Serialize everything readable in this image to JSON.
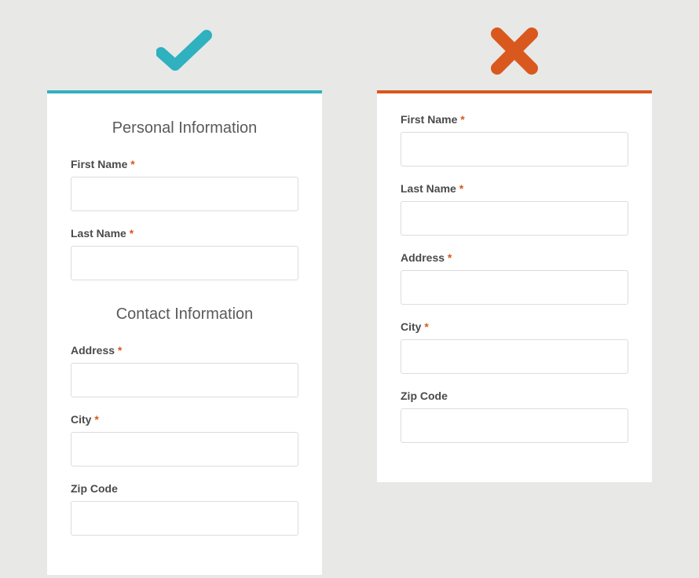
{
  "colors": {
    "good": "#2fb1bf",
    "bad": "#d9581e"
  },
  "goodForm": {
    "section1Title": "Personal Information",
    "section2Title": "Contact Information",
    "fields": {
      "firstName": {
        "label": "First Name",
        "required": true,
        "value": ""
      },
      "lastName": {
        "label": "Last Name",
        "required": true,
        "value": ""
      },
      "address": {
        "label": "Address",
        "required": true,
        "value": ""
      },
      "city": {
        "label": "City",
        "required": true,
        "value": ""
      },
      "zip": {
        "label": "Zip Code",
        "required": false,
        "value": ""
      }
    }
  },
  "badForm": {
    "fields": {
      "firstName": {
        "label": "First Name",
        "required": true,
        "value": ""
      },
      "lastName": {
        "label": "Last Name",
        "required": true,
        "value": ""
      },
      "address": {
        "label": "Address",
        "required": true,
        "value": ""
      },
      "city": {
        "label": "City",
        "required": true,
        "value": ""
      },
      "zip": {
        "label": "Zip Code",
        "required": false,
        "value": ""
      }
    }
  },
  "requiredMark": "*"
}
